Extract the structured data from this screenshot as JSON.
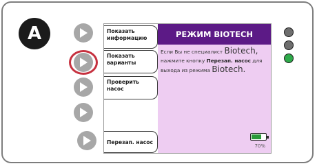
{
  "panel_label": "A",
  "screen": {
    "title": "РЕЖИМ BIOTECH",
    "message": {
      "part1": "Если Вы не специалист ",
      "brand1": "Biotech,",
      "part2": " нажмите кнопку ",
      "bold_button": "Перезап. насос",
      "part3": " для выхода из режима ",
      "brand2": "Biotech."
    },
    "battery": {
      "percent_label": "70%",
      "level": 0.7
    }
  },
  "menu": {
    "show_info": {
      "line1": "Показать",
      "line2": "информацию"
    },
    "show_options": {
      "line1": "Показать",
      "line2": "варианты"
    },
    "check_pump": {
      "line1": "Проверить",
      "line2": "насос"
    },
    "restart_pump": {
      "label": "Перезап. насос"
    }
  },
  "leds": [
    {
      "color": "#6e6e6e"
    },
    {
      "color": "#6e6e6e"
    },
    {
      "color": "#2eaa4a"
    }
  ],
  "colors": {
    "title_bar": "#5c1a86",
    "content_bg": "#eecdf2",
    "highlight_ring": "#c6313f",
    "side_button": "#a7a7a7"
  }
}
